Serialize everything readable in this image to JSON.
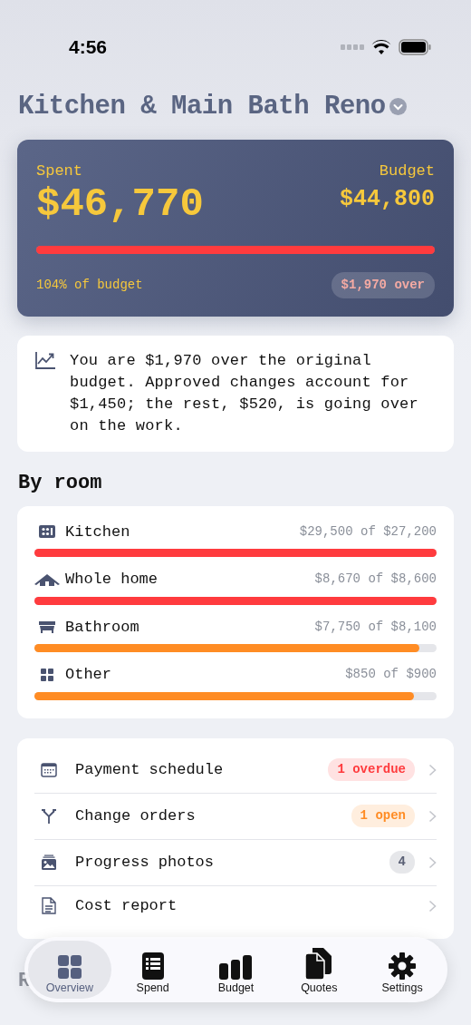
{
  "status_bar": {
    "time": "4:56"
  },
  "project": {
    "title": "Kitchen & Main Bath Reno"
  },
  "summary": {
    "spent_label": "Spent",
    "spent": "$46,770",
    "budget_label": "Budget",
    "budget": "$44,800",
    "level": 1,
    "percent_text": "104% of budget",
    "over_badge": "$1,970 over"
  },
  "insight": {
    "text": "You are $1,970 over the original budget. Approved changes account for $1,450; the rest, $520, is going over on the work."
  },
  "rooms_heading": "By room",
  "rooms": [
    {
      "kind": "kitchen",
      "name": "Kitchen",
      "amount": "$29,500 of $27,200",
      "level": 1,
      "over": true
    },
    {
      "kind": "home",
      "name": "Whole home",
      "amount": "$8,670 of $8,600",
      "level": 1,
      "over": true
    },
    {
      "kind": "bath",
      "name": "Bathroom",
      "amount": "$7,750 of $8,100",
      "level": 0.957,
      "over": false
    },
    {
      "kind": "other",
      "name": "Other",
      "amount": "$850 of $900",
      "level": 0.944,
      "over": false
    }
  ],
  "links": [
    {
      "kind": "calendar",
      "label": "Payment schedule",
      "badge": "1 overdue",
      "color": "#ff3b3e"
    },
    {
      "kind": "branch",
      "label": "Change orders",
      "badge": "1 open",
      "color": "#ff8c24"
    },
    {
      "kind": "photos",
      "label": "Progress photos",
      "badge": "4",
      "color": "#5a6075"
    },
    {
      "kind": "document",
      "label": "Cost report"
    }
  ],
  "next_heading": "R",
  "tabs": [
    {
      "kind": "grid",
      "label": "Overview",
      "selected": true
    },
    {
      "kind": "list",
      "label": "Spend",
      "selected": false
    },
    {
      "kind": "bars",
      "label": "Budget",
      "selected": false
    },
    {
      "kind": "docs",
      "label": "Quotes",
      "selected": false
    },
    {
      "kind": "gear",
      "label": "Settings",
      "selected": false
    }
  ]
}
